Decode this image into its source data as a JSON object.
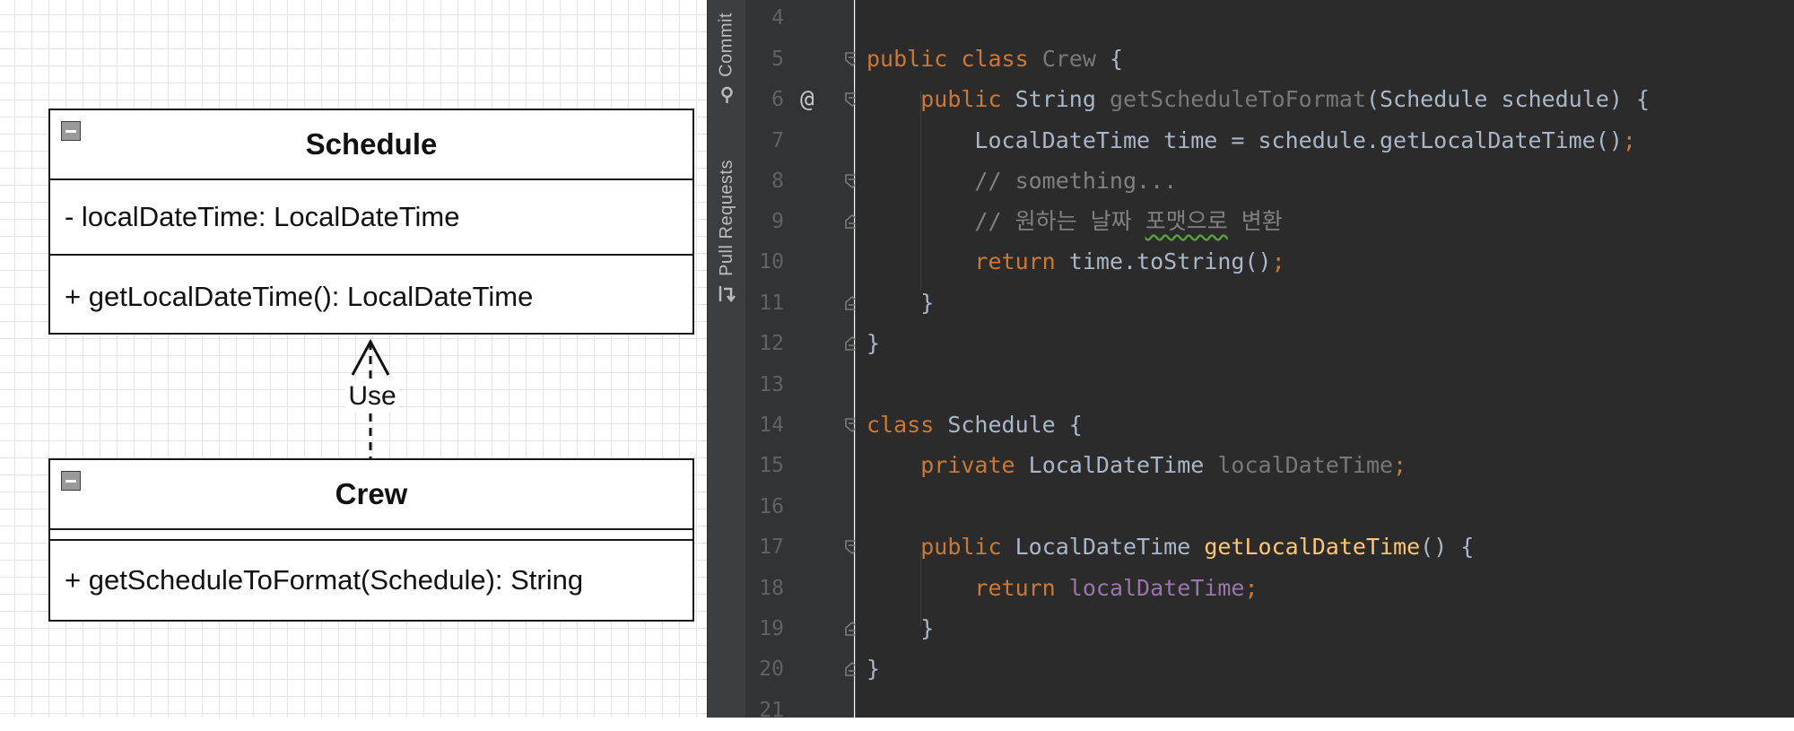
{
  "diagram": {
    "schedule": {
      "name": "Schedule",
      "attribute": "- localDateTime: LocalDateTime",
      "method": "+ getLocalDateTime(): LocalDateTime"
    },
    "crew": {
      "name": "Crew",
      "method": "+ getScheduleToFormat(Schedule): String"
    },
    "relation_label": "Use"
  },
  "toolwindows": {
    "commit": "Commit",
    "pull_requests": "Pull Requests"
  },
  "gutter": {
    "line_numbers": [
      "4",
      "5",
      "6",
      "7",
      "8",
      "9",
      "10",
      "11",
      "12",
      "13",
      "14",
      "15",
      "16",
      "17",
      "18",
      "19",
      "20",
      "21"
    ],
    "override_marker": "@"
  },
  "code": {
    "l5": {
      "kw1": "public",
      "kw2": "class",
      "name": "Crew",
      "rest": " {"
    },
    "l6": {
      "kw": "public",
      "type": "String",
      "method": "getScheduleToFormat",
      "params": "(Schedule schedule) {"
    },
    "l7": {
      "text": "LocalDateTime time = schedule.getLocalDateTime()",
      "semi": ";"
    },
    "l8": {
      "comment": "// something..."
    },
    "l9": {
      "comment_a": "// 원하는 날짜 ",
      "comment_b": "포맷으로",
      "comment_c": " 변환"
    },
    "l10": {
      "kw": "return",
      "text": " time.toString()",
      "semi": ";"
    },
    "l11": {
      "text": "}"
    },
    "l12": {
      "text": "}"
    },
    "l14": {
      "kw": "class",
      "name": "Schedule",
      "rest": " {"
    },
    "l15": {
      "kw": "private",
      "type": "LocalDateTime",
      "field": "localDateTime",
      "semi": ";"
    },
    "l17": {
      "kw": "public",
      "type": "LocalDateTime",
      "method": "getLocalDateTime",
      "rest": "() {"
    },
    "l18": {
      "kw": "return",
      "field": "localDateTime",
      "semi": ";"
    },
    "l19": {
      "text": "}"
    },
    "l20": {
      "text": "}"
    }
  },
  "colors": {
    "keyword": "#cc7832",
    "method_decl": "#ffc66d",
    "field": "#9876aa",
    "comment": "#808080",
    "plain": "#a9b7c6",
    "editor_bg": "#2b2b2b",
    "gutter_bg": "#313335"
  }
}
